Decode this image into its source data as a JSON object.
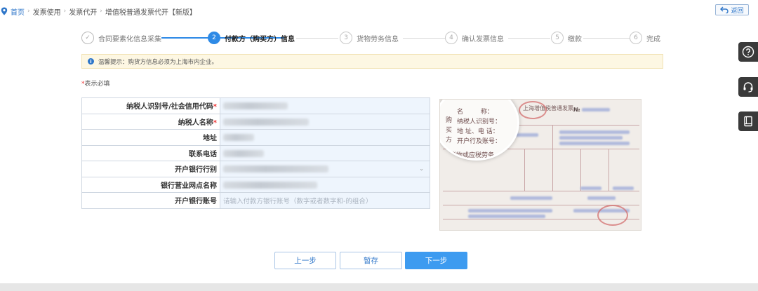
{
  "breadcrumb": {
    "items": [
      "首页",
      "发票使用",
      "发票代开",
      "增值税普通发票代开【新版】"
    ]
  },
  "back_button": {
    "label": "返回"
  },
  "steps": [
    {
      "number": "✓",
      "label": "合同要素化信息采集",
      "state": "done"
    },
    {
      "number": "2",
      "label": "付款方（购买方）信息",
      "state": "active"
    },
    {
      "number": "3",
      "label": "货物劳务信息",
      "state": "pending"
    },
    {
      "number": "4",
      "label": "确认发票信息",
      "state": "pending"
    },
    {
      "number": "5",
      "label": "缴款",
      "state": "pending"
    },
    {
      "number": "6",
      "label": "完成",
      "state": "pending"
    }
  ],
  "notice": {
    "icon": "info-icon",
    "text": "温馨提示：购货方信息必须为上海市内企业。"
  },
  "required_hint": {
    "star": "*",
    "text": "表示必填"
  },
  "form": {
    "rows": [
      {
        "label": "纳税人识别号/社会信用代码",
        "required": "*"
      },
      {
        "label": "纳税人名称",
        "required": "*"
      },
      {
        "label": "地址",
        "required": ""
      },
      {
        "label": "联系电话",
        "required": ""
      },
      {
        "label": "开户银行行别",
        "required": ""
      },
      {
        "label": "银行营业网点名称",
        "required": ""
      },
      {
        "label": "开户银行账号",
        "required": ""
      }
    ],
    "account_placeholder": "请输入付款方银行账号（数字或者数字和-的组合）"
  },
  "invoice_image": {
    "title": "上海增值税普通发票",
    "number_prefix": "№",
    "magnified_labels": [
      "名",
      "称：",
      "纳税人识别号：",
      "地 址、电 话：",
      "开户行及账号：",
      "货物或应税劳务"
    ],
    "side_labels": [
      "购",
      "买",
      "方"
    ]
  },
  "buttons": {
    "prev": "上一步",
    "save": "暂存",
    "next": "下一步"
  },
  "colors": {
    "primary": "#2e8ae6",
    "notice_bg": "#fdf7e3",
    "required": "#e33333"
  }
}
